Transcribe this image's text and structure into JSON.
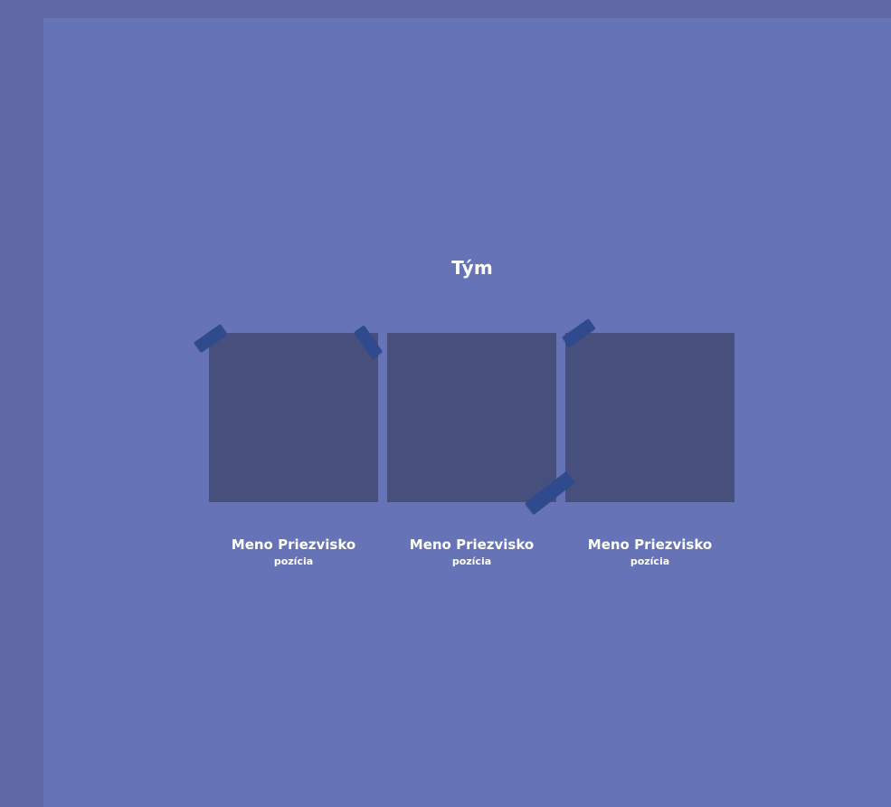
{
  "section": {
    "title": "Tým"
  },
  "team": {
    "members": [
      {
        "name": "Meno Priezvisko",
        "role": "pozícia"
      },
      {
        "name": "Meno Priezvisko",
        "role": "pozícia"
      },
      {
        "name": "Meno Priezvisko",
        "role": "pozícia"
      }
    ]
  },
  "colors": {
    "outer_background": "#6068a6",
    "page_background": "#6673b6",
    "photo_placeholder": "#47507d",
    "tape": "#2f4b8e",
    "text": "#ffffff"
  }
}
